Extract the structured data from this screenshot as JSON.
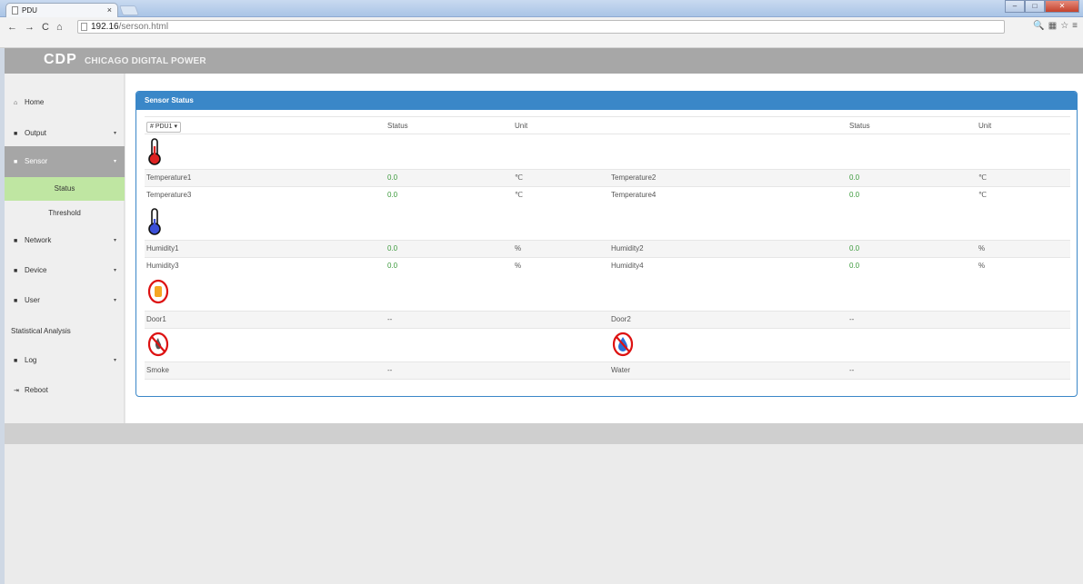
{
  "browser": {
    "tab_title": "PDU",
    "tab_close": "×",
    "url_host": "192.16",
    "url_path": "/serson.html"
  },
  "header": {
    "logo": "CDP",
    "brand": "CHICAGO DIGITAL POWER"
  },
  "sidebar": {
    "items": [
      {
        "label": "Home",
        "icon": "home-icon"
      },
      {
        "label": "Output",
        "icon": "list-icon"
      },
      {
        "label": "Sensor",
        "icon": "list-icon"
      },
      {
        "label": "Network",
        "icon": "list-icon"
      },
      {
        "label": "Device",
        "icon": "list-icon"
      },
      {
        "label": "User",
        "icon": "list-icon"
      },
      {
        "label": "Statistical Analysis",
        "icon": ""
      },
      {
        "label": "Log",
        "icon": "list-icon"
      },
      {
        "label": "Reboot",
        "icon": "reboot-icon"
      }
    ],
    "sensor_sub": [
      {
        "label": "Status"
      },
      {
        "label": "Threshold"
      }
    ]
  },
  "panel": {
    "title": "Sensor Status",
    "pdu_select": "# PDU1 ▾",
    "col_status": "Status",
    "col_unit": "Unit",
    "col_status2": "Status",
    "col_unit2": "Unit",
    "temperature": [
      {
        "name": "Temperature1",
        "status": "0.0",
        "unit": "℃",
        "name2": "Temperature2",
        "status2": "0.0",
        "unit2": "℃"
      },
      {
        "name": "Temperature3",
        "status": "0.0",
        "unit": "℃",
        "name2": "Temperature4",
        "status2": "0.0",
        "unit2": "℃"
      }
    ],
    "humidity": [
      {
        "name": "Humidity1",
        "status": "0.0",
        "unit": "%",
        "name2": "Humidity2",
        "status2": "0.0",
        "unit2": "%"
      },
      {
        "name": "Humidity3",
        "status": "0.0",
        "unit": "%",
        "name2": "Humidity4",
        "status2": "0.0",
        "unit2": "%"
      }
    ],
    "door": {
      "name": "Door1",
      "status": "--",
      "name2": "Door2",
      "status2": "--"
    },
    "smoke_water": {
      "name": "Smoke",
      "status": "--",
      "name2": "Water",
      "status2": "--"
    }
  },
  "colors": {
    "accent_blue": "#3a87c8",
    "status_green": "#3c9a3c",
    "selected_green": "#bfe6a2"
  }
}
